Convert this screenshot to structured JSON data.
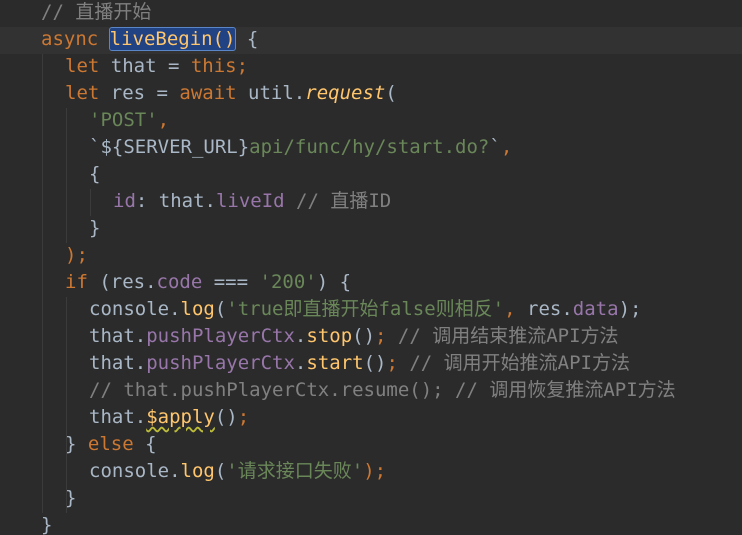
{
  "code_lines": [
    {
      "indent": 1,
      "tokens": [
        {
          "t": "// 直播开始",
          "c": "comment"
        }
      ]
    },
    {
      "indent": 1,
      "tokens": [
        {
          "t": "async ",
          "c": "kw"
        },
        {
          "t": "liveBegin()",
          "c": "fn selected"
        },
        {
          "t": " {",
          "c": "plain"
        }
      ]
    },
    {
      "indent": 2,
      "tokens": [
        {
          "t": "let ",
          "c": "kw"
        },
        {
          "t": "that = ",
          "c": "plain"
        },
        {
          "t": "this",
          "c": "kw"
        },
        {
          "t": ";",
          "c": "kw"
        }
      ]
    },
    {
      "indent": 2,
      "tokens": [
        {
          "t": "let ",
          "c": "kw"
        },
        {
          "t": "res = ",
          "c": "plain"
        },
        {
          "t": "await ",
          "c": "kw"
        },
        {
          "t": "util.",
          "c": "plain"
        },
        {
          "t": "request",
          "c": "fn italic"
        },
        {
          "t": "(",
          "c": "plain"
        }
      ]
    },
    {
      "indent": 3,
      "tokens": [
        {
          "t": "'POST'",
          "c": "str"
        },
        {
          "t": ",",
          "c": "kw"
        }
      ]
    },
    {
      "indent": 3,
      "tokens": [
        {
          "t": "`${SERVER_URL}",
          "c": "plain"
        },
        {
          "t": "api/func/hy/start.do?",
          "c": "str"
        },
        {
          "t": "`",
          "c": "plain"
        },
        {
          "t": ",",
          "c": "kw"
        }
      ]
    },
    {
      "indent": 3,
      "tokens": [
        {
          "t": "{",
          "c": "plain"
        }
      ]
    },
    {
      "indent": 4,
      "tokens": [
        {
          "t": "id",
          "c": "prop"
        },
        {
          "t": ": that.",
          "c": "plain"
        },
        {
          "t": "liveId",
          "c": "prop"
        },
        {
          "t": " // 直播ID",
          "c": "comment"
        }
      ]
    },
    {
      "indent": 3,
      "tokens": [
        {
          "t": "}",
          "c": "plain"
        }
      ]
    },
    {
      "indent": 2,
      "tokens": [
        {
          "t": ");",
          "c": "kw"
        }
      ]
    },
    {
      "indent": 2,
      "tokens": [
        {
          "t": "if ",
          "c": "kw"
        },
        {
          "t": "(res.",
          "c": "plain"
        },
        {
          "t": "code",
          "c": "prop"
        },
        {
          "t": " === ",
          "c": "plain"
        },
        {
          "t": "'200'",
          "c": "str"
        },
        {
          "t": ") {",
          "c": "plain"
        }
      ]
    },
    {
      "indent": 3,
      "tokens": [
        {
          "t": "console.",
          "c": "plain"
        },
        {
          "t": "log",
          "c": "fn"
        },
        {
          "t": "(",
          "c": "plain"
        },
        {
          "t": "'true即直播开始false则相反'",
          "c": "str"
        },
        {
          "t": ", ",
          "c": "kw"
        },
        {
          "t": "res.",
          "c": "plain"
        },
        {
          "t": "data",
          "c": "prop"
        },
        {
          "t": ");",
          "c": "plain"
        }
      ]
    },
    {
      "indent": 3,
      "tokens": [
        {
          "t": "that.",
          "c": "plain"
        },
        {
          "t": "pushPlayerCtx",
          "c": "prop"
        },
        {
          "t": ".",
          "c": "plain"
        },
        {
          "t": "stop",
          "c": "fn"
        },
        {
          "t": "()",
          "c": "plain"
        },
        {
          "t": ";",
          "c": "kw"
        },
        {
          "t": " // 调用结束推流API方法",
          "c": "comment"
        }
      ]
    },
    {
      "indent": 3,
      "tokens": [
        {
          "t": "that.",
          "c": "plain"
        },
        {
          "t": "pushPlayerCtx",
          "c": "prop"
        },
        {
          "t": ".",
          "c": "plain"
        },
        {
          "t": "start",
          "c": "fn"
        },
        {
          "t": "()",
          "c": "plain"
        },
        {
          "t": ";",
          "c": "kw"
        },
        {
          "t": " // 调用开始推流API方法",
          "c": "comment"
        }
      ]
    },
    {
      "indent": 3,
      "tokens": [
        {
          "t": "// that.pushPlayerCtx.resume(); // 调用恢复推流API方法",
          "c": "comment"
        }
      ]
    },
    {
      "indent": 3,
      "tokens": [
        {
          "t": "that.",
          "c": "plain"
        },
        {
          "t": "$apply",
          "c": "fn squiggle"
        },
        {
          "t": "()",
          "c": "plain"
        },
        {
          "t": ";",
          "c": "kw"
        }
      ]
    },
    {
      "indent": 2,
      "tokens": [
        {
          "t": "} ",
          "c": "plain"
        },
        {
          "t": "else ",
          "c": "kw"
        },
        {
          "t": "{",
          "c": "plain"
        }
      ]
    },
    {
      "indent": 3,
      "tokens": [
        {
          "t": "console.",
          "c": "plain"
        },
        {
          "t": "log",
          "c": "fn"
        },
        {
          "t": "(",
          "c": "plain"
        },
        {
          "t": "'请求接口失败'",
          "c": "str"
        },
        {
          "t": ");",
          "c": "kw"
        }
      ]
    },
    {
      "indent": 2,
      "tokens": [
        {
          "t": "}",
          "c": "plain"
        }
      ]
    },
    {
      "indent": 1,
      "tokens": [
        {
          "t": "}",
          "c": "plain"
        }
      ]
    }
  ],
  "colors": {
    "background": "#2b2b2b",
    "keyword": "#cc7832",
    "comment": "#808080",
    "string": "#6a8759",
    "function": "#ffc66d",
    "property": "#9876aa",
    "plain": "#a9b7c6",
    "selection": "#214283"
  }
}
